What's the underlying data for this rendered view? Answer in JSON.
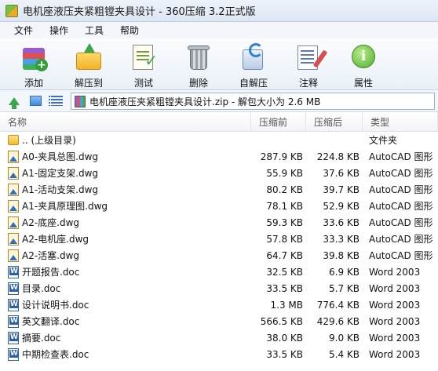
{
  "window": {
    "title": "电机座液压夹紧粗镗夹具设计 - 360压缩 3.2正式版"
  },
  "menu": [
    "文件",
    "操作",
    "工具",
    "帮助"
  ],
  "toolbar": [
    {
      "label": "添加",
      "icon": "add-archive-icon"
    },
    {
      "label": "解压到",
      "icon": "extract-folder-icon"
    },
    {
      "label": "测试",
      "icon": "test-checklist-icon"
    },
    {
      "label": "删除",
      "icon": "trash-bin-icon"
    },
    {
      "label": "自解压",
      "icon": "self-extract-icon"
    },
    {
      "label": "注释",
      "icon": "comment-note-icon"
    },
    {
      "label": "属性",
      "icon": "info-properties-icon"
    }
  ],
  "address": {
    "text": "电机座液压夹紧粗镗夹具设计.zip - 解包大小为 2.6 MB"
  },
  "columns": {
    "name": "名称",
    "compressed": "压缩前",
    "original": "压缩后",
    "type": "类型"
  },
  "files": [
    {
      "icon": "folder",
      "name": ".. (上级目录)",
      "compressed": "",
      "original": "",
      "type": "文件夹"
    },
    {
      "icon": "dwg",
      "name": "A0-夹具总图.dwg",
      "compressed": "287.9 KB",
      "original": "224.8 KB",
      "type": "AutoCAD 图形"
    },
    {
      "icon": "dwg",
      "name": "A1-固定支架.dwg",
      "compressed": "55.9 KB",
      "original": "37.6 KB",
      "type": "AutoCAD 图形"
    },
    {
      "icon": "dwg",
      "name": "A1-活动支架.dwg",
      "compressed": "80.2 KB",
      "original": "39.7 KB",
      "type": "AutoCAD 图形"
    },
    {
      "icon": "dwg",
      "name": "A1-夹具原理图.dwg",
      "compressed": "78.1 KB",
      "original": "52.9 KB",
      "type": "AutoCAD 图形"
    },
    {
      "icon": "dwg",
      "name": "A2-底座.dwg",
      "compressed": "59.3 KB",
      "original": "33.6 KB",
      "type": "AutoCAD 图形"
    },
    {
      "icon": "dwg",
      "name": "A2-电机座.dwg",
      "compressed": "57.8 KB",
      "original": "33.3 KB",
      "type": "AutoCAD 图形"
    },
    {
      "icon": "dwg",
      "name": "A2-活塞.dwg",
      "compressed": "64.7 KB",
      "original": "39.8 KB",
      "type": "AutoCAD 图形"
    },
    {
      "icon": "doc",
      "name": "开题报告.doc",
      "compressed": "32.5 KB",
      "original": "6.9 KB",
      "type": "Word 2003"
    },
    {
      "icon": "doc",
      "name": "目录.doc",
      "compressed": "33.5 KB",
      "original": "5.7 KB",
      "type": "Word 2003"
    },
    {
      "icon": "doc",
      "name": "设计说明书.doc",
      "compressed": "1.3 MB",
      "original": "776.4 KB",
      "type": "Word 2003"
    },
    {
      "icon": "doc",
      "name": "英文翻译.doc",
      "compressed": "566.5 KB",
      "original": "429.6 KB",
      "type": "Word 2003"
    },
    {
      "icon": "doc",
      "name": "摘要.doc",
      "compressed": "38.0 KB",
      "original": "9.0 KB",
      "type": "Word 2003"
    },
    {
      "icon": "doc",
      "name": "中期检查表.doc",
      "compressed": "33.5 KB",
      "original": "5.4 KB",
      "type": "Word 2003"
    }
  ]
}
